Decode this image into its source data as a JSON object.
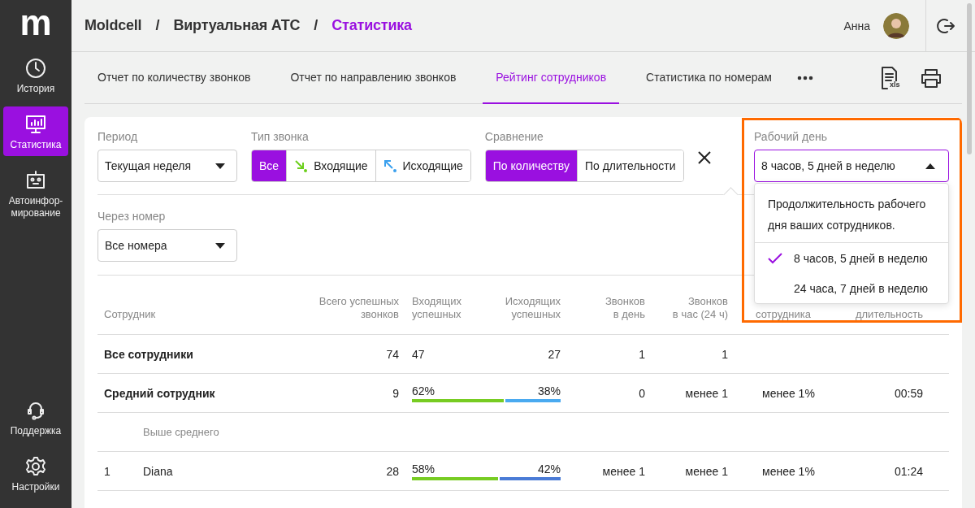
{
  "sidebar": {
    "logo": "m",
    "items": [
      {
        "label": "История",
        "kind": "clock",
        "selected": false
      },
      {
        "label": "Статистика",
        "kind": "chart",
        "selected": true
      },
      {
        "label": "Автоинфор-мирование",
        "kind": "robot",
        "selected": false
      }
    ],
    "bottom_items": [
      {
        "label": "Поддержка",
        "kind": "headset",
        "selected": false
      },
      {
        "label": "Настройки",
        "kind": "gear",
        "selected": false
      }
    ]
  },
  "header": {
    "breadcrumbs": [
      {
        "label": "Moldcell",
        "selected": false
      },
      {
        "label": "Виртуальная АТС",
        "selected": false
      },
      {
        "label": "Статистика",
        "selected": true
      }
    ],
    "separators": [
      "/",
      "/"
    ],
    "user": "Анна"
  },
  "tabs": [
    {
      "label": "Отчет по количеству звонков",
      "selected": false
    },
    {
      "label": "Отчет по направлению звонков",
      "selected": false
    },
    {
      "label": "Рейтинг сотрудников",
      "selected": true
    },
    {
      "label": "Статистика по номерам",
      "selected": false
    }
  ],
  "tab_tools": {
    "export_label": "xls"
  },
  "filters": {
    "period": {
      "label": "Период",
      "value": "Текущая неделя"
    },
    "call_type": {
      "label": "Тип звонка",
      "options": [
        {
          "label": "Все",
          "kind": "all",
          "selected": true
        },
        {
          "label": "Входящие",
          "kind": "incoming",
          "selected": false
        },
        {
          "label": "Исходящие",
          "kind": "outgoing",
          "selected": false
        }
      ]
    },
    "comparison": {
      "label": "Сравнение",
      "options": [
        {
          "label": "По количеству",
          "selected": true
        },
        {
          "label": "По длительности",
          "selected": false
        }
      ]
    },
    "via_number": {
      "label": "Через номер",
      "value": "Все номера"
    },
    "work_day": {
      "label": "Рабочий день",
      "value": "8 часов, 5 дней в неделю",
      "expanded": true,
      "highlighted": true,
      "hint": "Продолжительность рабочего дня ваших сотрудников.",
      "options": [
        {
          "label": "8 часов, 5 дней в неделю",
          "selected": true
        },
        {
          "label": "24 часа, 7 дней в неделю",
          "selected": false
        }
      ]
    }
  },
  "table": {
    "columns": [
      "Сотрудник",
      "Всего успешных\nзвонков",
      "Входящих\nуспешных",
      "Исходящих\nуспешных",
      "Звонков\nв день",
      "Звонков\nв час (24 ч)",
      "сотрудника",
      "длительность"
    ],
    "rows": [
      {
        "kind": "total",
        "name": "Все сотрудники",
        "total": "74",
        "incoming": "47",
        "outgoing": "27",
        "per_day": "1",
        "per_hour": "1"
      },
      {
        "kind": "average",
        "name": "Средний сотрудник",
        "total": "9",
        "incoming": "62%",
        "outgoing": "38%",
        "bar": {
          "level": 0.62,
          "color": "#4aaaf0"
        },
        "per_day": "0",
        "per_hour": "менее 1",
        "column_7": "менее 1%",
        "column_8": "00:59"
      },
      {
        "kind": "section",
        "name": "Выше среднего"
      },
      {
        "kind": "employee",
        "rank": "1",
        "name": "Diana",
        "total": "28",
        "incoming": "58%",
        "outgoing": "42%",
        "bar": {
          "level": 0.58,
          "color": "#4a7bd6"
        },
        "per_day": "менее 1",
        "per_hour": "менее 1",
        "column_7": "менее 1%",
        "column_8": "01:24"
      }
    ]
  }
}
